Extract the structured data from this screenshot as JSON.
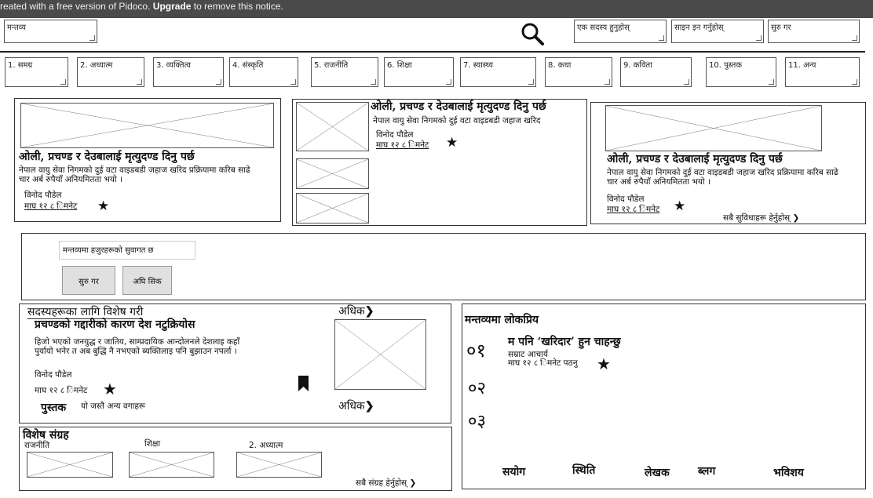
{
  "notice": {
    "prefix": "reated with a free version of Pidoco. ",
    "upgrade": "Upgrade",
    "suffix": " to remove this notice."
  },
  "header": {
    "logo_label": "मन्तव्य",
    "member_label": "एक सदस्य हुनुहोस्",
    "signin_label": "साइन इन गर्नुहोस्",
    "start_label": "सुरु गर"
  },
  "nav": {
    "items": [
      "1. समग्र",
      "2. अध्यात्म",
      "3. व्यक्तित्व",
      "4. संस्कृति",
      "5. राजनीति",
      "6. शिक्षा",
      "7. स्वास्थ्य",
      "8. कथा",
      "9. कविता",
      "10. पुस्तक",
      "11. अन्य"
    ]
  },
  "featured": {
    "card1": {
      "title": "ओली, प्रचण्ड र देउबालाई मृत्युदण्ड दिनु पर्छ",
      "summary": "नेपाल वायु सेवा निगमको दुई वटा वाइडबडी जहाज खरिद प्रक्रियामा करिब साढे चार अर्ब रुपैयाँ अनियमितता भयो ।",
      "author": "विनोद पौडेल",
      "meta": "माघ १२ ८ िमनेट"
    },
    "card2": {
      "title": "ओली, प्रचण्ड र देउबालाई मृत्युदण्ड दिनु पर्छ",
      "summary": "नेपाल वायु सेवा निगमको दुई वटा वाइडबडी जहाज खरिद",
      "author": "विनोद पौडेल",
      "meta": "माघ १२ ८ िमनेट"
    },
    "card3": {
      "title": "ओली, प्रचण्ड र देउबालाई मृत्युदण्ड दिनु पर्छ",
      "summary": "नेपाल वायु सेवा निगमको दुई वटा वाइडबडी जहाज खरिद प्रक्रियामा करिब साढे चार अर्ब रुपैयाँ अनियमितता भयो ।",
      "author": "विनोद पौडेल",
      "meta": "माघ १२ ८ िमनेट",
      "see_all": "सबै सुविधाहरू हेर्नुहोस्"
    }
  },
  "welcome": {
    "message": "मन्तव्यमा हजुरहरूको सुवागत छ",
    "start_button": "सुरु गर",
    "already_button": "अघि सिक"
  },
  "members": {
    "heading": "सदस्यहरूका लागि विशेष गरी",
    "more_top": "अधिक",
    "title": "प्रचण्डको गद्दारीको कारण देश नटुक्रियोस",
    "summary": "हिजो भएको जनयुद्ध र जातिय, साम्प्रदायिक आन्दोलनले देशलाइ कहाँ पुर्यायो भनेर त अब बुद्धि नै नभएको ब्यक्तिलाइ पनि बुझाउन नपर्ला ।",
    "author": "विनोद पौडेल",
    "meta": "माघ १२ ८ िमनेट",
    "more_bottom": "अधिक",
    "tag_label": "पुस्तक",
    "tag_desc": "यो जस्तै अन्य वगाहरू"
  },
  "collection": {
    "heading": "विशेष संग्रह",
    "items": [
      "राजनीति",
      "शिक्षा",
      "2. अध्यात्म"
    ],
    "see_all": "सबै संग्रह हेर्नुहोस्"
  },
  "popular": {
    "heading": "मन्तव्यमा लोकप्रिय",
    "numbers": [
      "०१",
      "०२",
      "०३"
    ],
    "item_title": "म पनि ‘खरिदार’ हुन चाहन्छु",
    "item_author": "सम्राट आचार्य",
    "item_meta": "माघ १२ ८ िमनेट पठनु"
  },
  "footer": {
    "links": [
      "सयोग",
      "स्थिति",
      "लेखक",
      "ब्लग",
      "भविशय"
    ]
  },
  "icons": {
    "search": "search-icon",
    "star": "star-icon",
    "bookmark": "bookmark-icon",
    "chevron": "chevron-right-icon"
  }
}
